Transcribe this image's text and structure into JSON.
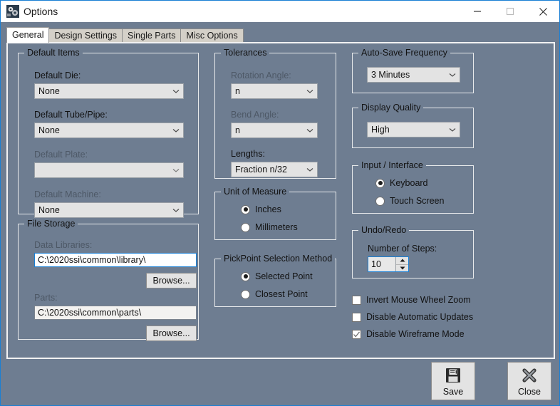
{
  "window": {
    "title": "Options",
    "icon": "options-gear-icon",
    "minimize_label": "Minimize",
    "maximize_label": "Maximize",
    "close_label": "Close",
    "background_color": "#6e7d91",
    "accent_color": "#1a7fd4"
  },
  "tabs": [
    {
      "label": "General",
      "active": true
    },
    {
      "label": "Design Settings",
      "active": false
    },
    {
      "label": "Single Parts",
      "active": false
    },
    {
      "label": "Misc Options",
      "active": false
    }
  ],
  "default_items": {
    "legend": "Default Items",
    "die_label": "Default Die:",
    "die_value": "None",
    "tube_label": "Default Tube/Pipe:",
    "tube_value": "None",
    "plate_label": "Default Plate:",
    "plate_value": "",
    "machine_label": "Default Machine:",
    "machine_value": "None"
  },
  "file_storage": {
    "legend": "File Storage",
    "data_libraries_label": "Data Libraries:",
    "data_libraries_value": "C:\\2020ssi\\common\\library\\",
    "data_libraries_browse": "Browse...",
    "parts_label": "Parts:",
    "parts_value": "C:\\2020ssi\\common\\parts\\",
    "parts_browse": "Browse..."
  },
  "tolerances": {
    "legend": "Tolerances",
    "rotation_label": "Rotation Angle:",
    "rotation_value": "n",
    "bend_label": "Bend Angle:",
    "bend_value": "n",
    "lengths_label": "Lengths:",
    "lengths_value": "Fraction n/32"
  },
  "unit_of_measure": {
    "legend": "Unit of Measure",
    "options": [
      {
        "label": "Inches",
        "selected": true
      },
      {
        "label": "Millimeters",
        "selected": false
      }
    ]
  },
  "pickpoint": {
    "legend": "PickPoint Selection Method",
    "options": [
      {
        "label": "Selected Point",
        "selected": true
      },
      {
        "label": "Closest Point",
        "selected": false
      }
    ]
  },
  "autosave": {
    "legend": "Auto-Save Frequency",
    "value": "3 Minutes"
  },
  "display_quality": {
    "legend": "Display Quality",
    "value": "High"
  },
  "input_interface": {
    "legend": "Input / Interface",
    "options": [
      {
        "label": "Keyboard",
        "selected": true
      },
      {
        "label": "Touch Screen",
        "selected": false
      }
    ]
  },
  "undo_redo": {
    "legend": "Undo/Redo",
    "steps_label": "Number of Steps:",
    "steps_value": "10"
  },
  "checkboxes": [
    {
      "label": "Invert Mouse Wheel Zoom",
      "checked": false
    },
    {
      "label": "Disable Automatic Updates",
      "checked": false
    },
    {
      "label": "Disable Wireframe Mode",
      "checked": true
    }
  ],
  "actions": {
    "save_label": "Save",
    "save_icon": "floppy-disk-icon",
    "close_label": "Close",
    "close_icon": "x-cross-icon"
  }
}
